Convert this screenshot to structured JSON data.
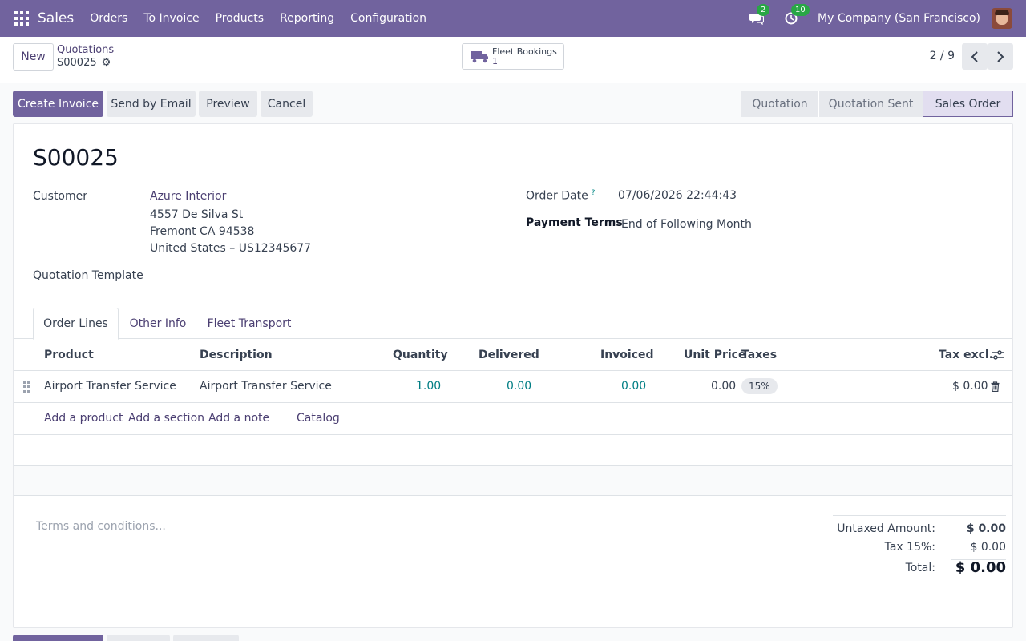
{
  "navbar": {
    "brand": "Sales",
    "menu": [
      "Orders",
      "To Invoice",
      "Products",
      "Reporting",
      "Configuration"
    ],
    "messages_count": "2",
    "activities_count": "10",
    "company": "My Company (San Francisco)"
  },
  "control": {
    "new_label": "New",
    "breadcrumb_parent": "Quotations",
    "breadcrumb_current": "S00025",
    "smart_button_label": "Fleet Bookings",
    "smart_button_value": "1",
    "pager": "2 / 9"
  },
  "actions": {
    "create_invoice": "Create Invoice",
    "send_email": "Send by Email",
    "preview": "Preview",
    "cancel": "Cancel"
  },
  "status": {
    "stages": [
      "Quotation",
      "Quotation Sent",
      "Sales Order"
    ],
    "active": "Sales Order"
  },
  "form": {
    "title": "S00025",
    "customer_label": "Customer",
    "customer_name": "Azure Interior",
    "address_line1": "4557 De Silva St",
    "address_line2": "Fremont CA 94538",
    "address_line3": "United States – US12345677",
    "template_label": "Quotation Template",
    "order_date_label": "Order Date",
    "order_date_help": "?",
    "order_date": "07/06/2026 22:44:43",
    "payment_terms_label": "Payment Terms",
    "payment_terms": "End of Following Month"
  },
  "tabs": [
    "Order Lines",
    "Other Info",
    "Fleet Transport"
  ],
  "table": {
    "headers": {
      "product": "Product",
      "description": "Description",
      "quantity": "Quantity",
      "delivered": "Delivered",
      "invoiced": "Invoiced",
      "unit_price": "Unit Price",
      "taxes": "Taxes",
      "tax_excl": "Tax excl."
    },
    "rows": [
      {
        "product": "Airport Transfer Service",
        "description": "Airport Transfer Service",
        "quantity": "1.00",
        "delivered": "0.00",
        "invoiced": "0.00",
        "unit_price": "0.00",
        "tax": "15%",
        "subtotal": "$ 0.00"
      }
    ],
    "add_links": [
      "Add a product",
      "Add a section",
      "Add a note",
      "Catalog"
    ]
  },
  "footer": {
    "terms_placeholder": "Terms and conditions...",
    "untaxed_label": "Untaxed Amount:",
    "untaxed_value": "$ 0.00",
    "tax_label": "Tax 15%:",
    "tax_value": "$ 0.00",
    "total_label": "Total:",
    "total_value": "$ 0.00"
  },
  "colors": {
    "brand": "#71639e",
    "link": "#4b3f72",
    "numeric_link": "#017e84",
    "badge_green": "#28a745"
  }
}
